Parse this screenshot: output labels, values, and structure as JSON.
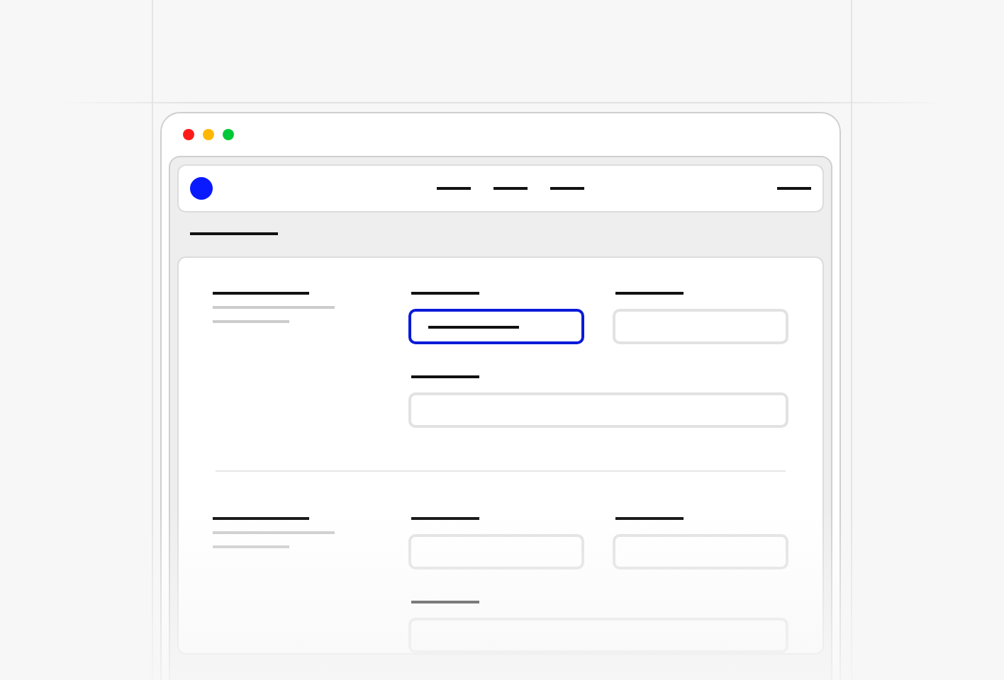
{
  "window": {
    "controls": [
      {
        "color": "#ff1a1a"
      },
      {
        "color": "#ffb700"
      },
      {
        "color": "#00c838"
      }
    ]
  },
  "nav": {
    "links": [
      {
        "kind": "link"
      },
      {
        "kind": "link"
      },
      {
        "kind": "link"
      }
    ],
    "menu": {
      "kind": "menu"
    }
  },
  "tabs": [
    {
      "selected": true
    }
  ],
  "sections": [
    {
      "fields": [
        {
          "kind": "half",
          "focused": true,
          "filled": true
        },
        {
          "kind": "half",
          "focused": false,
          "filled": false
        },
        {
          "kind": "full",
          "focused": false,
          "filled": false
        }
      ]
    },
    {
      "fields": [
        {
          "kind": "half",
          "focused": false,
          "filled": false
        },
        {
          "kind": "half",
          "focused": false,
          "filled": false
        },
        {
          "kind": "full",
          "focused": false,
          "filled": false
        }
      ]
    }
  ]
}
